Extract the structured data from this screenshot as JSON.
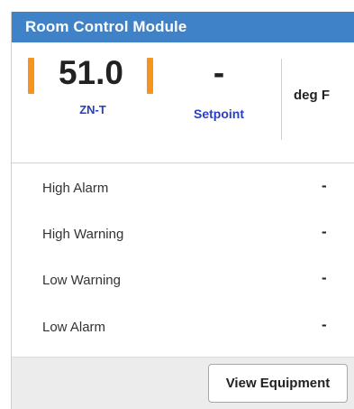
{
  "header": {
    "title": "Room Control Module"
  },
  "reading": {
    "value": "51.0",
    "label": "ZN-T"
  },
  "setpoint": {
    "value": "-",
    "label": "Setpoint"
  },
  "unit": "deg F",
  "alarms": [
    {
      "label": "High Alarm",
      "value": "-"
    },
    {
      "label": "High Warning",
      "value": "-"
    },
    {
      "label": "Low Warning",
      "value": "-"
    },
    {
      "label": "Low Alarm",
      "value": "-"
    }
  ],
  "footer": {
    "view_equipment_label": "View Equipment"
  },
  "colors": {
    "header_bg": "#3f82c8",
    "accent_bar": "#f7941d",
    "label_blue": "#2a3fbf"
  }
}
